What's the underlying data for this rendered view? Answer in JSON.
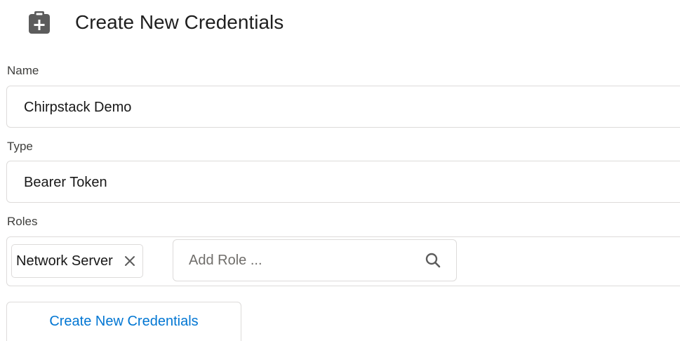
{
  "header": {
    "title": "Create New Credentials",
    "icon": "clipboard-plus-icon"
  },
  "form": {
    "name": {
      "label": "Name",
      "value": "Chirpstack Demo"
    },
    "type": {
      "label": "Type",
      "value": "Bearer Token"
    },
    "roles": {
      "label": "Roles",
      "selected": [
        "Network Server"
      ],
      "remove_icon": "close-icon",
      "search_placeholder": "Add Role ...",
      "search_value": "",
      "search_icon": "search-icon"
    }
  },
  "actions": {
    "submit_label": "Create New Credentials"
  },
  "colors": {
    "accent": "#0176d3",
    "border": "#dddbda",
    "icon": "#5c5c5c",
    "label": "#3e3e3c",
    "text": "#181818"
  }
}
